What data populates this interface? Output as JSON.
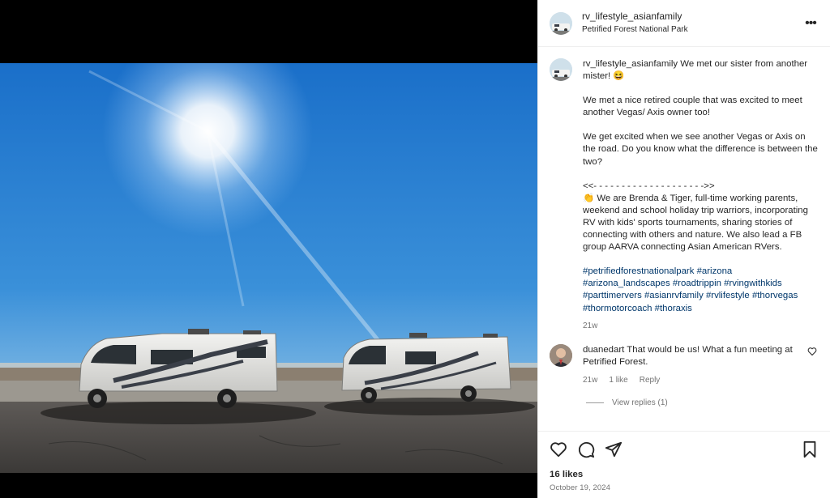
{
  "post": {
    "username": "rv_lifestyle_asianfamily",
    "location": "Petrified Forest National Park",
    "more_label": "•••"
  },
  "caption": {
    "username": "rv_lifestyle_asianfamily",
    "line1": "We met our sister from another mister! 😆",
    "para2": "We met a nice retired couple that was excited to meet another Vegas/ Axis owner too!",
    "para3": "We get excited when we see another Vegas or Axis on the road. Do you know what the difference is between the two?",
    "divider": "<<- - - - - - - - - - - - - - - - - - - ->>",
    "para4": "👏 We are Brenda & Tiger, full-time working parents, weekend and school holiday trip warriors, incorporating RV with kids' sports tournaments, sharing stories of connecting with others and nature. We also lead a FB group AARVA connecting Asian American RVers.",
    "hashtags": [
      "#petrifiedforestnationalpark",
      "#arizona",
      "#arizona_landscapes",
      "#roadtrippin",
      "#rvingwithkids",
      "#parttimervers",
      "#asianrvfamily",
      "#rvlifestyle",
      "#thorvegas",
      "#thormotorcoach",
      "#thoraxis"
    ],
    "age": "21w"
  },
  "comment": {
    "username": "duanedart",
    "text": "That would be us! What a fun meeting at Petrified Forest.",
    "age": "21w",
    "likes": "1 like",
    "reply": "Reply",
    "view_replies": "View replies (1)"
  },
  "footer": {
    "likes": "16 likes",
    "date": "October 19, 2024"
  },
  "icons": [
    "heart-icon",
    "comment-icon",
    "share-icon",
    "bookmark-icon",
    "more-icon"
  ]
}
